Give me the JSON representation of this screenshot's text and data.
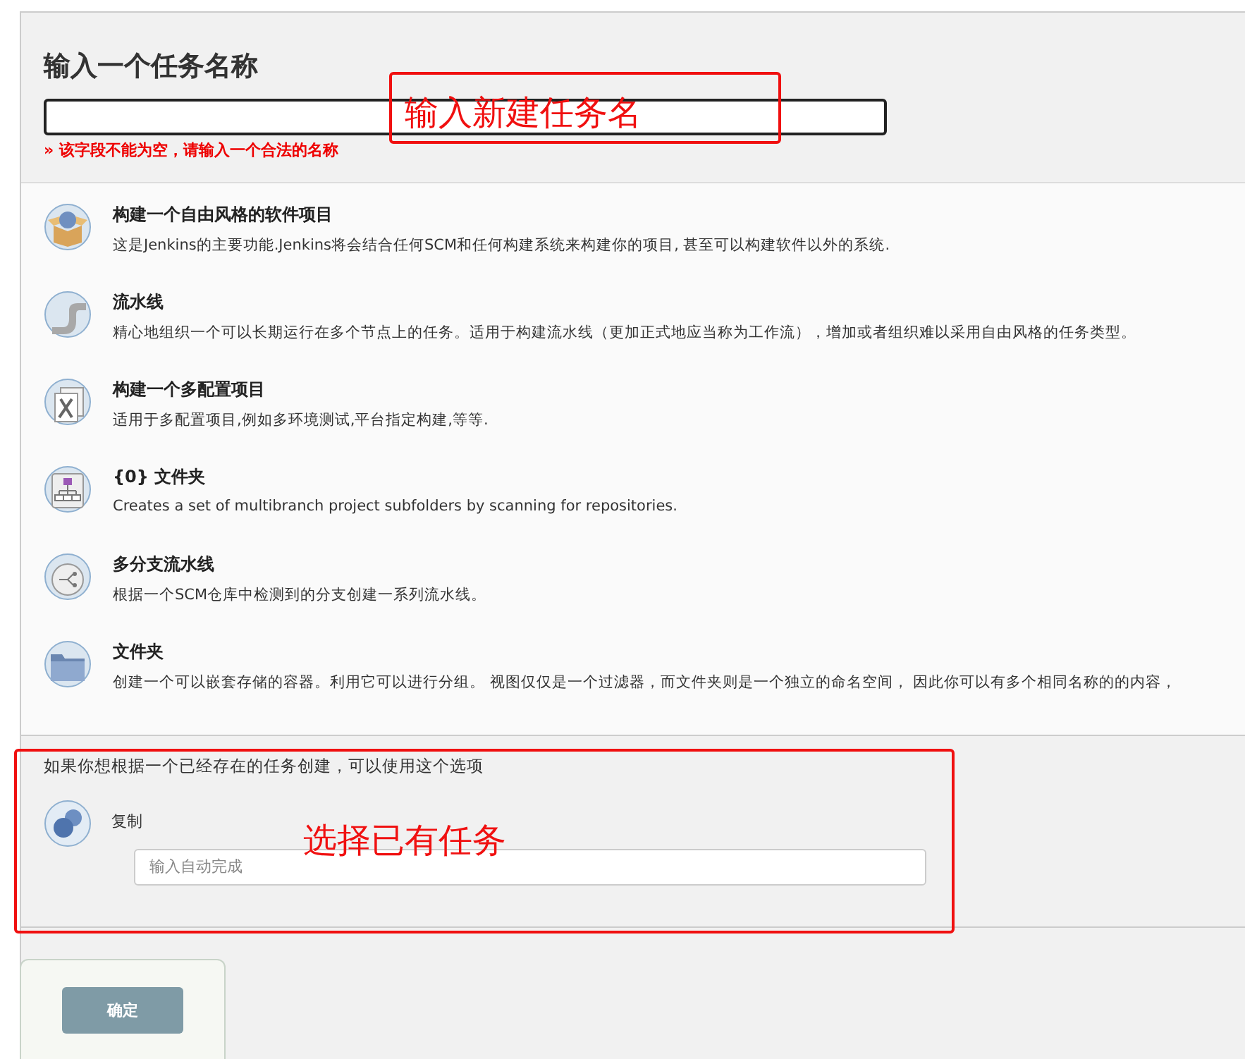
{
  "name_section": {
    "title": "输入一个任务名称",
    "error": "» 该字段不能为空，请输入一个合法的名称"
  },
  "job_types": [
    {
      "name": "构建一个自由风格的软件项目",
      "description": "这是Jenkins的主要功能.Jenkins将会结合任何SCM和任何构建系统来构建你的项目, 甚至可以构建软件以外的系统."
    },
    {
      "name": "流水线",
      "description": "精心地组织一个可以长期运行在多个节点上的任务。适用于构建流水线（更加正式地应当称为工作流），增加或者组织难以采用自由风格的任务类型。"
    },
    {
      "name": "构建一个多配置项目",
      "description": "适用于多配置项目,例如多环境测试,平台指定构建,等等."
    },
    {
      "name": "{0} 文件夹",
      "description": "Creates a set of multibranch project subfolders by scanning for repositories."
    },
    {
      "name": "多分支流水线",
      "description": "根据一个SCM仓库中检测到的分支创建一系列流水线。"
    },
    {
      "name": "文件夹",
      "description": "创建一个可以嵌套存储的容器。利用它可以进行分组。 视图仅仅是一个过滤器，而文件夹则是一个独立的命名空间， 因此你可以有多个相同名称的的内容，"
    }
  ],
  "copy_section": {
    "hint": "如果你想根据一个已经存在的任务创建，可以使用这个选项",
    "label": "复制",
    "placeholder": "输入自动完成"
  },
  "ok_button": "确定",
  "annotations": [
    {
      "text": "输入新建任务名"
    },
    {
      "text": "选择已有任务"
    }
  ]
}
